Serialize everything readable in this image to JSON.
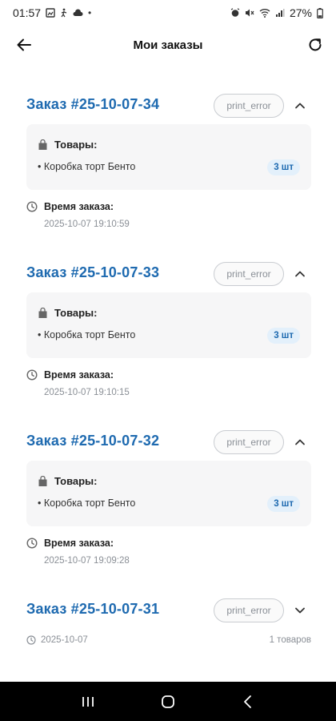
{
  "status_bar": {
    "time": "01:57",
    "battery": "27%"
  },
  "app_bar": {
    "title": "Мои заказы"
  },
  "orders": [
    {
      "title": "Заказ #25-10-07-34",
      "status": "print_error",
      "expanded": true,
      "goods_label": "Товары:",
      "item": "• Коробка торт Бенто",
      "qty": "3 шт",
      "time_label": "Время заказа:",
      "time_value": "2025-10-07 19:10:59"
    },
    {
      "title": "Заказ #25-10-07-33",
      "status": "print_error",
      "expanded": true,
      "goods_label": "Товары:",
      "item": "• Коробка торт Бенто",
      "qty": "3 шт",
      "time_label": "Время заказа:",
      "time_value": "2025-10-07 19:10:15"
    },
    {
      "title": "Заказ #25-10-07-32",
      "status": "print_error",
      "expanded": true,
      "goods_label": "Товары:",
      "item": "• Коробка торт Бенто",
      "qty": "3 шт",
      "time_label": "Время заказа:",
      "time_value": "2025-10-07 19:09:28"
    },
    {
      "title": "Заказ #25-10-07-31",
      "status": "print_error",
      "expanded": false,
      "date": "2025-10-07",
      "count": "1 товаров"
    }
  ],
  "colors": {
    "accent": "#1e6ab0",
    "badge_bg": "#e3f0fb",
    "card_bg": "#f6f6f7",
    "muted": "#8a8f96"
  }
}
